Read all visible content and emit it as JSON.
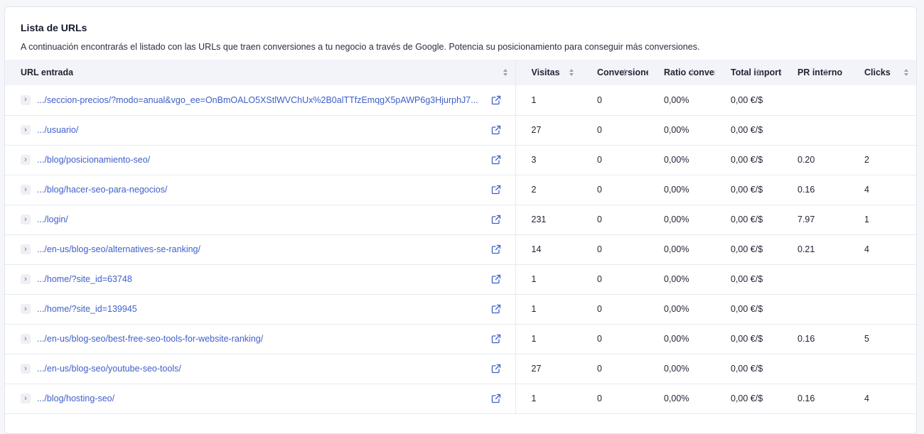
{
  "card": {
    "title": "Lista de URLs",
    "description": "A continuación encontrarás el listado con las URLs que traen conversiones a tu negocio a través de Google. Potencia su posicionamiento para conseguir más conversiones."
  },
  "table": {
    "columns": {
      "url": "URL entrada",
      "visitas": "Visitas",
      "conversiones": "Conversiones",
      "ratio": "Ratio conversión",
      "total": "Total importe",
      "pr": "PR interno",
      "clicks": "Clicks"
    },
    "rows": [
      {
        "url": ".../seccion-precios/?modo=anual&vgo_ee=OnBmOALO5XStlWVChUx%2B0alTTfzEmqgX5pAWP6g3HjurphJ7...",
        "visitas": "1",
        "conversiones": "0",
        "ratio": "0,00%",
        "total": "0,00 €/$",
        "pr": "",
        "clicks": ""
      },
      {
        "url": ".../usuario/",
        "visitas": "27",
        "conversiones": "0",
        "ratio": "0,00%",
        "total": "0,00 €/$",
        "pr": "",
        "clicks": ""
      },
      {
        "url": ".../blog/posicionamiento-seo/",
        "visitas": "3",
        "conversiones": "0",
        "ratio": "0,00%",
        "total": "0,00 €/$",
        "pr": "0.20",
        "clicks": "2"
      },
      {
        "url": ".../blog/hacer-seo-para-negocios/",
        "visitas": "2",
        "conversiones": "0",
        "ratio": "0,00%",
        "total": "0,00 €/$",
        "pr": "0.16",
        "clicks": "4"
      },
      {
        "url": ".../login/",
        "visitas": "231",
        "conversiones": "0",
        "ratio": "0,00%",
        "total": "0,00 €/$",
        "pr": "7.97",
        "clicks": "1"
      },
      {
        "url": ".../en-us/blog-seo/alternatives-se-ranking/",
        "visitas": "14",
        "conversiones": "0",
        "ratio": "0,00%",
        "total": "0,00 €/$",
        "pr": "0.21",
        "clicks": "4"
      },
      {
        "url": ".../home/?site_id=63748",
        "visitas": "1",
        "conversiones": "0",
        "ratio": "0,00%",
        "total": "0,00 €/$",
        "pr": "",
        "clicks": ""
      },
      {
        "url": ".../home/?site_id=139945",
        "visitas": "1",
        "conversiones": "0",
        "ratio": "0,00%",
        "total": "0,00 €/$",
        "pr": "",
        "clicks": ""
      },
      {
        "url": ".../en-us/blog-seo/best-free-seo-tools-for-website-ranking/",
        "visitas": "1",
        "conversiones": "0",
        "ratio": "0,00%",
        "total": "0,00 €/$",
        "pr": "0.16",
        "clicks": "5"
      },
      {
        "url": ".../en-us/blog-seo/youtube-seo-tools/",
        "visitas": "27",
        "conversiones": "0",
        "ratio": "0,00%",
        "total": "0,00 €/$",
        "pr": "",
        "clicks": ""
      },
      {
        "url": ".../blog/hosting-seo/",
        "visitas": "1",
        "conversiones": "0",
        "ratio": "0,00%",
        "total": "0,00 €/$",
        "pr": "0.16",
        "clicks": "4"
      }
    ]
  },
  "icons": {
    "expand": "chevron-right-icon",
    "external": "external-link-icon",
    "sort": "sort-icon"
  },
  "colors": {
    "link": "#3e5fc9",
    "header_bg": "#f3f4f9"
  }
}
